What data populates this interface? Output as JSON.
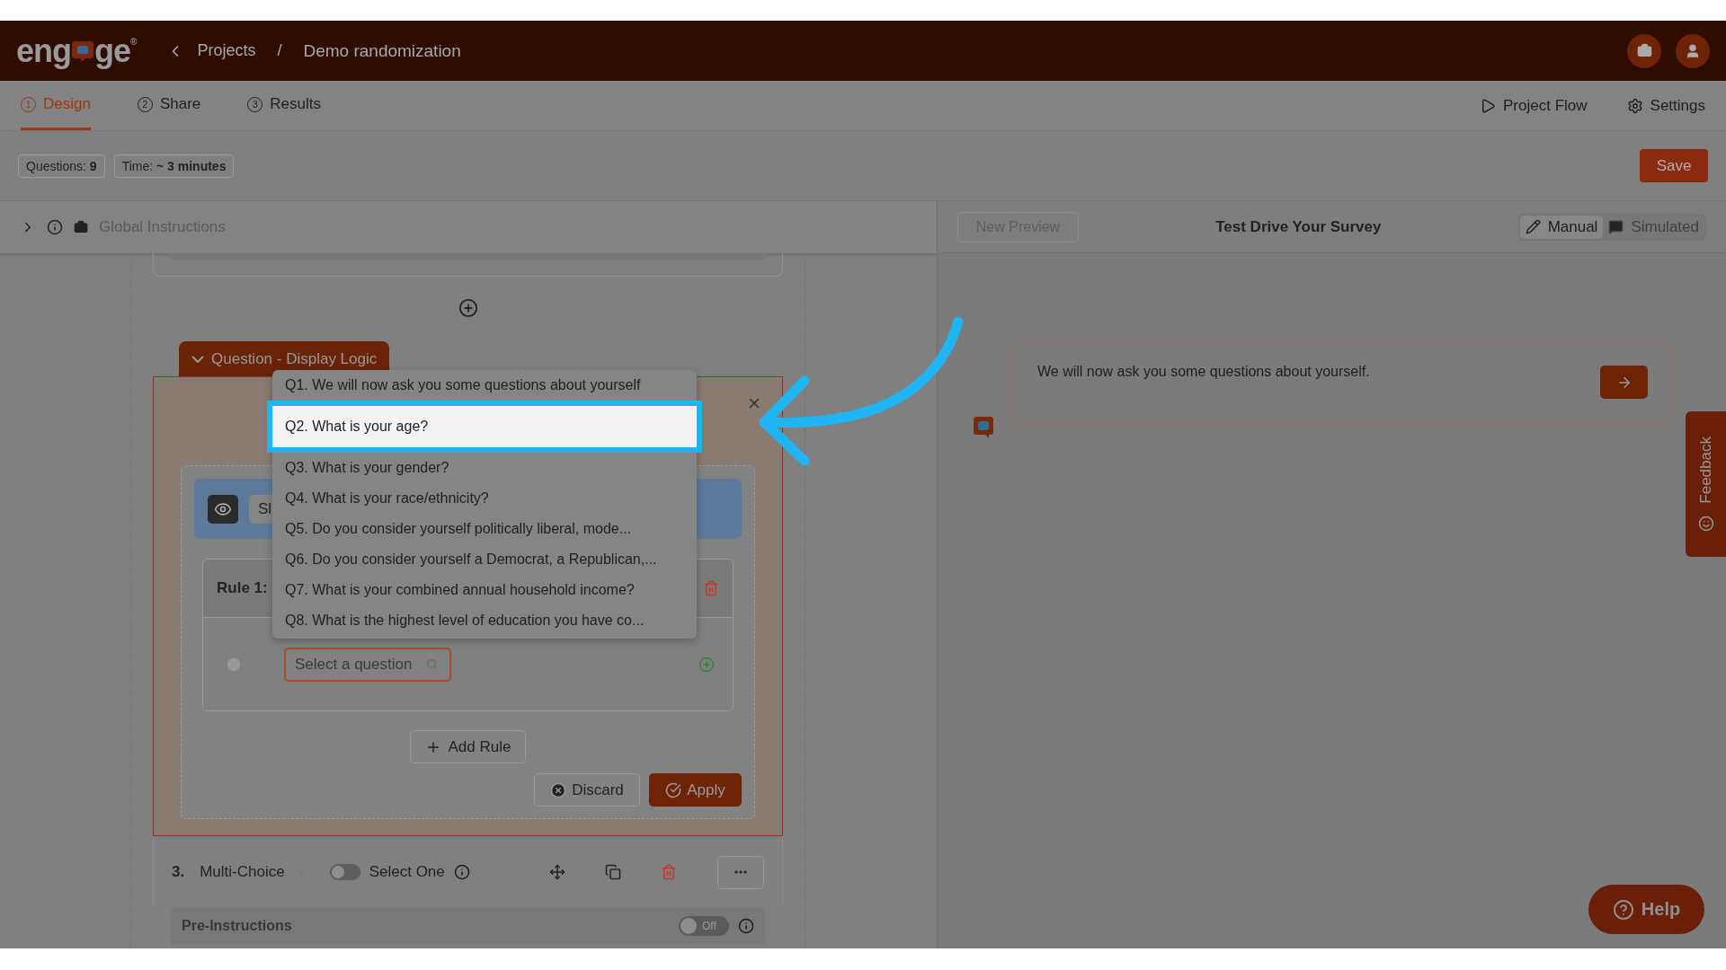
{
  "header": {
    "logo_start": "eng",
    "logo_end": "ge",
    "logo_mark": "®",
    "breadcrumbs": [
      "Projects",
      "Demo randomization"
    ],
    "separator": "/"
  },
  "tabs": [
    {
      "number": "1",
      "label": "Design",
      "selected": true
    },
    {
      "number": "2",
      "label": "Share",
      "selected": false
    },
    {
      "number": "3",
      "label": "Results",
      "selected": false
    }
  ],
  "actions": [
    {
      "kind": "play",
      "label": "Project Flow"
    },
    {
      "kind": "settings",
      "label": "Settings"
    }
  ],
  "stats": [
    {
      "label": "Questions:",
      "value": "9"
    },
    {
      "label": "Time:",
      "value": "~ 3 minutes"
    }
  ],
  "save": "Save",
  "global_instructions": {
    "label": "Global Instructions",
    "expanded": false
  },
  "logic_panel": {
    "tab_label": "Question - Display Logic",
    "expanded": true,
    "show_label": "Sl",
    "rule_label": "Rule 1:",
    "placeholder": "Select a question",
    "add_rule": "Add Rule",
    "discard": "Discard",
    "apply": "Apply"
  },
  "dropdown": {
    "options": [
      {
        "label": "Q1. We will now ask you some questions about yourself",
        "selected": false
      },
      {
        "label": "Q2. What is your age?",
        "selected": true
      },
      {
        "label": "Q3. What is your gender?",
        "selected": false
      },
      {
        "label": "Q4. What is your race/ethnicity?",
        "selected": false
      },
      {
        "label": "Q5. Do you consider yourself politically liberal, mode...",
        "selected": false
      },
      {
        "label": "Q6. Do you consider yourself a Democrat, a Republican,...",
        "selected": false
      },
      {
        "label": "Q7. What is your combined annual household income?",
        "selected": false
      },
      {
        "label": "Q8. What is the highest level of education you have co...",
        "selected": false
      }
    ]
  },
  "question_row": {
    "number": "3.",
    "type": "Multi-Choice",
    "select_one": {
      "label": "Select One",
      "on": false
    }
  },
  "pre_instructions": {
    "label": "Pre-Instructions",
    "toggle": {
      "label": "Off",
      "on": false
    }
  },
  "preview": {
    "new_preview": "New Preview",
    "title": "Test Drive Your Survey",
    "modes": [
      {
        "kind": "manual",
        "label": "Manual",
        "selected": true
      },
      {
        "kind": "simulated",
        "label": "Simulated",
        "selected": false
      }
    ],
    "message": "We will now ask you some questions about yourself."
  },
  "feedback": "Feedback",
  "help": "Help"
}
